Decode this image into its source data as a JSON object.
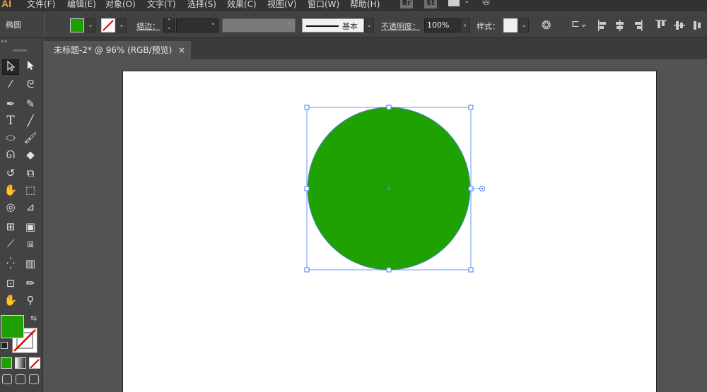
{
  "menubar": {
    "logo": "AI",
    "items": [
      "文件(F)",
      "编辑(E)",
      "对象(O)",
      "文字(T)",
      "选择(S)",
      "效果(C)",
      "视图(V)",
      "窗口(W)",
      "帮助(H)"
    ],
    "bridge": "Br",
    "stock": "St"
  },
  "control": {
    "object_type": "椭圆",
    "fill_color": "#1e9e00",
    "stroke_label": "描边：",
    "stroke_profile": "基本",
    "opacity_label": "不透明度：",
    "opacity_value": "100%",
    "style_label": "样式："
  },
  "document": {
    "tab_title": "未标题-2* @ 96% (RGB/预览)",
    "close_glyph": "×",
    "artboard_bg": "#ffffff"
  },
  "shape": {
    "type": "ellipse",
    "fill": "#1fa201",
    "selection_color": "#4a7df5"
  },
  "tools": {
    "fill_color": "#1fa201",
    "icons": [
      "selection-icon",
      "direct-selection-icon",
      "magic-wand-icon",
      "lasso-icon",
      "pen-icon",
      "curvature-icon",
      "type-icon",
      "line-icon",
      "ellipse-icon",
      "paintbrush-icon",
      "shaper-icon",
      "eraser-icon",
      "rotate-icon",
      "scale-icon",
      "warp-icon",
      "free-transform-icon",
      "shape-builder-icon",
      "perspective-grid-icon",
      "mesh-icon",
      "gradient-icon",
      "eyedropper-icon",
      "blend-icon",
      "symbol-sprayer-icon",
      "column-graph-icon",
      "artboard-icon",
      "slice-icon",
      "hand-icon",
      "zoom-icon"
    ]
  }
}
